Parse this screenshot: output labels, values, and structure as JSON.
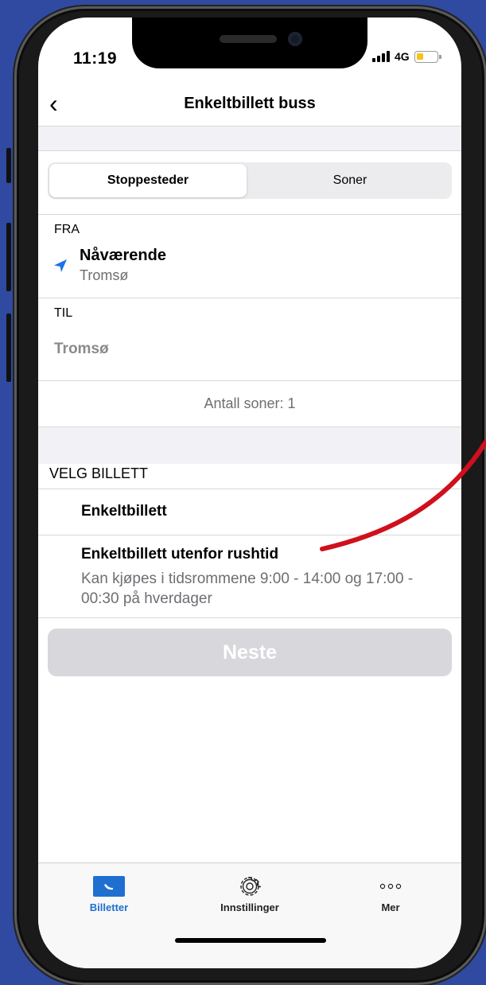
{
  "status_bar": {
    "time": "11:19",
    "network": "4G"
  },
  "nav": {
    "back_glyph": "‹",
    "title": "Enkeltbillett buss"
  },
  "segment": {
    "active": "Stoppesteder",
    "inactive": "Soner"
  },
  "from": {
    "label": "FRA",
    "title": "Nåværende",
    "subtitle": "Tromsø"
  },
  "to": {
    "label": "TIL",
    "value": "Tromsø"
  },
  "zones_text": "Antall soner: 1",
  "ticket_section": {
    "header": "VELG BILLETT",
    "options": [
      {
        "title": "Enkeltbillett"
      },
      {
        "title": "Enkeltbillett utenfor rushtid",
        "subtitle": "Kan kjøpes i tidsrommene 9:00 - 14:00 og 17:00 - 00:30 på hverdager"
      }
    ]
  },
  "next_button": {
    "label": "Neste",
    "state": "disabled"
  },
  "tabbar": {
    "items": [
      {
        "label": "Billetter",
        "icon": "ticket-icon",
        "active": true
      },
      {
        "label": "Innstillinger",
        "icon": "gear-icon",
        "active": false
      },
      {
        "label": "Mer",
        "icon": "more-dots-icon",
        "active": false
      }
    ]
  },
  "colors": {
    "accent": "#1f6fd0",
    "background": "#2f4aa0",
    "annotation": "#d0101c",
    "location_icon": "#1a73e8"
  }
}
